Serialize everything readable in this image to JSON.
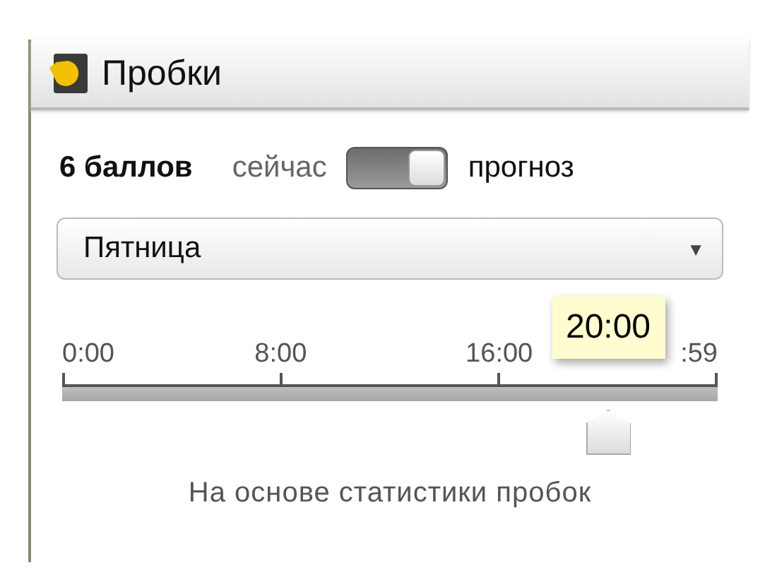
{
  "header": {
    "title": "Пробки"
  },
  "status": {
    "score": "6 баллов",
    "left_label": "сейчас",
    "right_label": "прогноз",
    "toggle": {
      "on": true
    }
  },
  "day_select": {
    "value": "Пятница",
    "arrow": "▼"
  },
  "timeline": {
    "ticks": [
      "0:00",
      "8:00",
      "16:00",
      ":59"
    ],
    "slider": {
      "level": 0.833
    },
    "tooltip": "20:00"
  },
  "footnote": "На основе статистики пробок"
}
